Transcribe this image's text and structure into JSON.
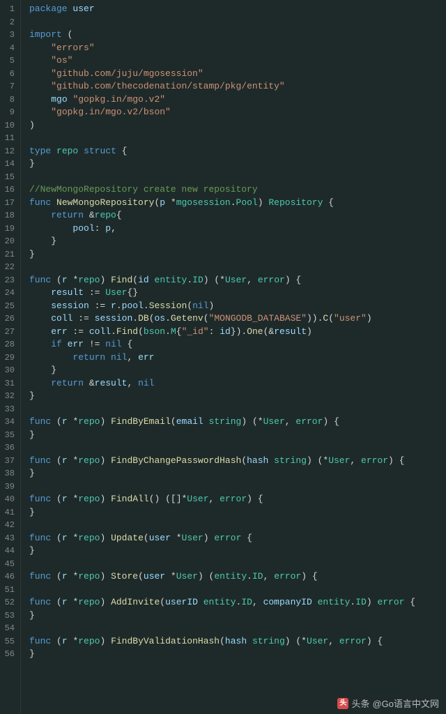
{
  "watermark": {
    "label": "头条",
    "handle": "@Go语言中文网"
  },
  "lines": [
    {
      "n": "1",
      "tokens": [
        [
          "kw",
          "package"
        ],
        [
          "op",
          " "
        ],
        [
          "ident",
          "user"
        ]
      ]
    },
    {
      "n": "2",
      "tokens": []
    },
    {
      "n": "3",
      "tokens": [
        [
          "kw",
          "import"
        ],
        [
          "op",
          " ("
        ]
      ]
    },
    {
      "n": "4",
      "tokens": [
        [
          "op",
          "    "
        ],
        [
          "str",
          "\"errors\""
        ]
      ]
    },
    {
      "n": "5",
      "tokens": [
        [
          "op",
          "    "
        ],
        [
          "str",
          "\"os\""
        ]
      ]
    },
    {
      "n": "6",
      "tokens": [
        [
          "op",
          "    "
        ],
        [
          "str",
          "\"github.com/juju/mgosession\""
        ]
      ]
    },
    {
      "n": "7",
      "tokens": [
        [
          "op",
          "    "
        ],
        [
          "str",
          "\"github.com/thecodenation/stamp/pkg/entity\""
        ]
      ]
    },
    {
      "n": "8",
      "tokens": [
        [
          "op",
          "    "
        ],
        [
          "ident",
          "mgo"
        ],
        [
          "op",
          " "
        ],
        [
          "str",
          "\"gopkg.in/mgo.v2\""
        ]
      ]
    },
    {
      "n": "9",
      "tokens": [
        [
          "op",
          "    "
        ],
        [
          "str",
          "\"gopkg.in/mgo.v2/bson\""
        ]
      ]
    },
    {
      "n": "10",
      "tokens": [
        [
          "op",
          ")"
        ]
      ]
    },
    {
      "n": "11",
      "tokens": []
    },
    {
      "n": "12",
      "tokens": [
        [
          "kw",
          "type"
        ],
        [
          "op",
          " "
        ],
        [
          "type",
          "repo"
        ],
        [
          "op",
          " "
        ],
        [
          "kw",
          "struct"
        ],
        [
          "op",
          " {"
        ]
      ]
    },
    {
      "n": "14",
      "tokens": [
        [
          "op",
          "}"
        ]
      ]
    },
    {
      "n": "15",
      "tokens": []
    },
    {
      "n": "16",
      "tokens": [
        [
          "comment",
          "//NewMongoRepository create new repository"
        ]
      ]
    },
    {
      "n": "17",
      "tokens": [
        [
          "kw",
          "func"
        ],
        [
          "op",
          " "
        ],
        [
          "fn",
          "NewMongoRepository"
        ],
        [
          "op",
          "("
        ],
        [
          "ident",
          "p"
        ],
        [
          "op",
          " *"
        ],
        [
          "type",
          "mgosession"
        ],
        [
          "op",
          "."
        ],
        [
          "type",
          "Pool"
        ],
        [
          "op",
          ") "
        ],
        [
          "type",
          "Repository"
        ],
        [
          "op",
          " {"
        ]
      ]
    },
    {
      "n": "18",
      "tokens": [
        [
          "op",
          "    "
        ],
        [
          "kw",
          "return"
        ],
        [
          "op",
          " &"
        ],
        [
          "type",
          "repo"
        ],
        [
          "op",
          "{"
        ]
      ]
    },
    {
      "n": "19",
      "tokens": [
        [
          "op",
          "        "
        ],
        [
          "ident",
          "pool"
        ],
        [
          "op",
          ": "
        ],
        [
          "ident",
          "p"
        ],
        [
          "op",
          ","
        ]
      ]
    },
    {
      "n": "20",
      "tokens": [
        [
          "op",
          "    }"
        ]
      ]
    },
    {
      "n": "21",
      "tokens": [
        [
          "op",
          "}"
        ]
      ]
    },
    {
      "n": "22",
      "tokens": []
    },
    {
      "n": "23",
      "tokens": [
        [
          "kw",
          "func"
        ],
        [
          "op",
          " ("
        ],
        [
          "ident",
          "r"
        ],
        [
          "op",
          " *"
        ],
        [
          "type",
          "repo"
        ],
        [
          "op",
          ") "
        ],
        [
          "fn",
          "Find"
        ],
        [
          "op",
          "("
        ],
        [
          "ident",
          "id"
        ],
        [
          "op",
          " "
        ],
        [
          "type",
          "entity"
        ],
        [
          "op",
          "."
        ],
        [
          "type",
          "ID"
        ],
        [
          "op",
          ") (*"
        ],
        [
          "type",
          "User"
        ],
        [
          "op",
          ", "
        ],
        [
          "type",
          "error"
        ],
        [
          "op",
          ") {"
        ]
      ]
    },
    {
      "n": "24",
      "tokens": [
        [
          "op",
          "    "
        ],
        [
          "ident",
          "result"
        ],
        [
          "op",
          " := "
        ],
        [
          "type",
          "User"
        ],
        [
          "op",
          "{}"
        ]
      ]
    },
    {
      "n": "25",
      "tokens": [
        [
          "op",
          "    "
        ],
        [
          "ident",
          "session"
        ],
        [
          "op",
          " := "
        ],
        [
          "ident",
          "r"
        ],
        [
          "op",
          "."
        ],
        [
          "ident",
          "pool"
        ],
        [
          "op",
          "."
        ],
        [
          "fn",
          "Session"
        ],
        [
          "op",
          "("
        ],
        [
          "const",
          "nil"
        ],
        [
          "op",
          ")"
        ]
      ]
    },
    {
      "n": "26",
      "tokens": [
        [
          "op",
          "    "
        ],
        [
          "ident",
          "coll"
        ],
        [
          "op",
          " := "
        ],
        [
          "ident",
          "session"
        ],
        [
          "op",
          "."
        ],
        [
          "fn",
          "DB"
        ],
        [
          "op",
          "("
        ],
        [
          "ident",
          "os"
        ],
        [
          "op",
          "."
        ],
        [
          "fn",
          "Getenv"
        ],
        [
          "op",
          "("
        ],
        [
          "str",
          "\"MONGODB_DATABASE\""
        ],
        [
          "op",
          "))."
        ],
        [
          "fn",
          "C"
        ],
        [
          "op",
          "("
        ],
        [
          "str",
          "\"user\""
        ],
        [
          "op",
          ")"
        ]
      ]
    },
    {
      "n": "27",
      "tokens": [
        [
          "op",
          "    "
        ],
        [
          "ident",
          "err"
        ],
        [
          "op",
          " := "
        ],
        [
          "ident",
          "coll"
        ],
        [
          "op",
          "."
        ],
        [
          "fn",
          "Find"
        ],
        [
          "op",
          "("
        ],
        [
          "type",
          "bson"
        ],
        [
          "op",
          "."
        ],
        [
          "type",
          "M"
        ],
        [
          "op",
          "{"
        ],
        [
          "str",
          "\"_id\""
        ],
        [
          "op",
          ": "
        ],
        [
          "ident",
          "id"
        ],
        [
          "op",
          "})."
        ],
        [
          "fn",
          "One"
        ],
        [
          "op",
          "(&"
        ],
        [
          "ident",
          "result"
        ],
        [
          "op",
          ")"
        ]
      ]
    },
    {
      "n": "28",
      "tokens": [
        [
          "op",
          "    "
        ],
        [
          "kw",
          "if"
        ],
        [
          "op",
          " "
        ],
        [
          "ident",
          "err"
        ],
        [
          "op",
          " != "
        ],
        [
          "const",
          "nil"
        ],
        [
          "op",
          " {"
        ]
      ]
    },
    {
      "n": "29",
      "tokens": [
        [
          "op",
          "        "
        ],
        [
          "kw",
          "return"
        ],
        [
          "op",
          " "
        ],
        [
          "const",
          "nil"
        ],
        [
          "op",
          ", "
        ],
        [
          "ident",
          "err"
        ]
      ]
    },
    {
      "n": "30",
      "tokens": [
        [
          "op",
          "    }"
        ]
      ]
    },
    {
      "n": "31",
      "tokens": [
        [
          "op",
          "    "
        ],
        [
          "kw",
          "return"
        ],
        [
          "op",
          " &"
        ],
        [
          "ident",
          "result"
        ],
        [
          "op",
          ", "
        ],
        [
          "const",
          "nil"
        ]
      ]
    },
    {
      "n": "32",
      "tokens": [
        [
          "op",
          "}"
        ]
      ]
    },
    {
      "n": "33",
      "tokens": []
    },
    {
      "n": "34",
      "tokens": [
        [
          "kw",
          "func"
        ],
        [
          "op",
          " ("
        ],
        [
          "ident",
          "r"
        ],
        [
          "op",
          " *"
        ],
        [
          "type",
          "repo"
        ],
        [
          "op",
          ") "
        ],
        [
          "fn",
          "FindByEmail"
        ],
        [
          "op",
          "("
        ],
        [
          "ident",
          "email"
        ],
        [
          "op",
          " "
        ],
        [
          "type",
          "string"
        ],
        [
          "op",
          ") (*"
        ],
        [
          "type",
          "User"
        ],
        [
          "op",
          ", "
        ],
        [
          "type",
          "error"
        ],
        [
          "op",
          ") {"
        ]
      ]
    },
    {
      "n": "35",
      "tokens": [
        [
          "op",
          "}"
        ]
      ]
    },
    {
      "n": "36",
      "tokens": []
    },
    {
      "n": "37",
      "tokens": [
        [
          "kw",
          "func"
        ],
        [
          "op",
          " ("
        ],
        [
          "ident",
          "r"
        ],
        [
          "op",
          " *"
        ],
        [
          "type",
          "repo"
        ],
        [
          "op",
          ") "
        ],
        [
          "fn",
          "FindByChangePasswordHash"
        ],
        [
          "op",
          "("
        ],
        [
          "ident",
          "hash"
        ],
        [
          "op",
          " "
        ],
        [
          "type",
          "string"
        ],
        [
          "op",
          ") (*"
        ],
        [
          "type",
          "User"
        ],
        [
          "op",
          ", "
        ],
        [
          "type",
          "error"
        ],
        [
          "op",
          ") {"
        ]
      ]
    },
    {
      "n": "38",
      "tokens": [
        [
          "op",
          "}"
        ]
      ]
    },
    {
      "n": "39",
      "tokens": []
    },
    {
      "n": "40",
      "tokens": [
        [
          "kw",
          "func"
        ],
        [
          "op",
          " ("
        ],
        [
          "ident",
          "r"
        ],
        [
          "op",
          " *"
        ],
        [
          "type",
          "repo"
        ],
        [
          "op",
          ") "
        ],
        [
          "fn",
          "FindAll"
        ],
        [
          "op",
          "() ([]*"
        ],
        [
          "type",
          "User"
        ],
        [
          "op",
          ", "
        ],
        [
          "type",
          "error"
        ],
        [
          "op",
          ") {"
        ]
      ]
    },
    {
      "n": "41",
      "tokens": [
        [
          "op",
          "}"
        ]
      ]
    },
    {
      "n": "42",
      "tokens": []
    },
    {
      "n": "43",
      "tokens": [
        [
          "kw",
          "func"
        ],
        [
          "op",
          " ("
        ],
        [
          "ident",
          "r"
        ],
        [
          "op",
          " *"
        ],
        [
          "type",
          "repo"
        ],
        [
          "op",
          ") "
        ],
        [
          "fn",
          "Update"
        ],
        [
          "op",
          "("
        ],
        [
          "ident",
          "user"
        ],
        [
          "op",
          " *"
        ],
        [
          "type",
          "User"
        ],
        [
          "op",
          ") "
        ],
        [
          "type",
          "error"
        ],
        [
          "op",
          " {"
        ]
      ]
    },
    {
      "n": "44",
      "tokens": [
        [
          "op",
          "}"
        ]
      ]
    },
    {
      "n": "45",
      "tokens": []
    },
    {
      "n": "46",
      "tokens": [
        [
          "kw",
          "func"
        ],
        [
          "op",
          " ("
        ],
        [
          "ident",
          "r"
        ],
        [
          "op",
          " *"
        ],
        [
          "type",
          "repo"
        ],
        [
          "op",
          ") "
        ],
        [
          "fn",
          "Store"
        ],
        [
          "op",
          "("
        ],
        [
          "ident",
          "user"
        ],
        [
          "op",
          " *"
        ],
        [
          "type",
          "User"
        ],
        [
          "op",
          ") ("
        ],
        [
          "type",
          "entity"
        ],
        [
          "op",
          "."
        ],
        [
          "type",
          "ID"
        ],
        [
          "op",
          ", "
        ],
        [
          "type",
          "error"
        ],
        [
          "op",
          ") {"
        ]
      ]
    },
    {
      "n": "51",
      "tokens": []
    },
    {
      "n": "52",
      "tokens": [
        [
          "kw",
          "func"
        ],
        [
          "op",
          " ("
        ],
        [
          "ident",
          "r"
        ],
        [
          "op",
          " *"
        ],
        [
          "type",
          "repo"
        ],
        [
          "op",
          ") "
        ],
        [
          "fn",
          "AddInvite"
        ],
        [
          "op",
          "("
        ],
        [
          "ident",
          "userID"
        ],
        [
          "op",
          " "
        ],
        [
          "type",
          "entity"
        ],
        [
          "op",
          "."
        ],
        [
          "type",
          "ID"
        ],
        [
          "op",
          ", "
        ],
        [
          "ident",
          "companyID"
        ],
        [
          "op",
          " "
        ],
        [
          "type",
          "entity"
        ],
        [
          "op",
          "."
        ],
        [
          "type",
          "ID"
        ],
        [
          "op",
          ") "
        ],
        [
          "type",
          "error"
        ],
        [
          "op",
          " {"
        ]
      ]
    },
    {
      "n": "53",
      "tokens": [
        [
          "op",
          "}"
        ]
      ]
    },
    {
      "n": "54",
      "tokens": []
    },
    {
      "n": "55",
      "tokens": [
        [
          "kw",
          "func"
        ],
        [
          "op",
          " ("
        ],
        [
          "ident",
          "r"
        ],
        [
          "op",
          " *"
        ],
        [
          "type",
          "repo"
        ],
        [
          "op",
          ") "
        ],
        [
          "fn",
          "FindByValidationHash"
        ],
        [
          "op",
          "("
        ],
        [
          "ident",
          "hash"
        ],
        [
          "op",
          " "
        ],
        [
          "type",
          "string"
        ],
        [
          "op",
          ") (*"
        ],
        [
          "type",
          "User"
        ],
        [
          "op",
          ", "
        ],
        [
          "type",
          "error"
        ],
        [
          "op",
          ") {"
        ]
      ]
    },
    {
      "n": "56",
      "tokens": [
        [
          "op",
          "}"
        ]
      ]
    }
  ]
}
